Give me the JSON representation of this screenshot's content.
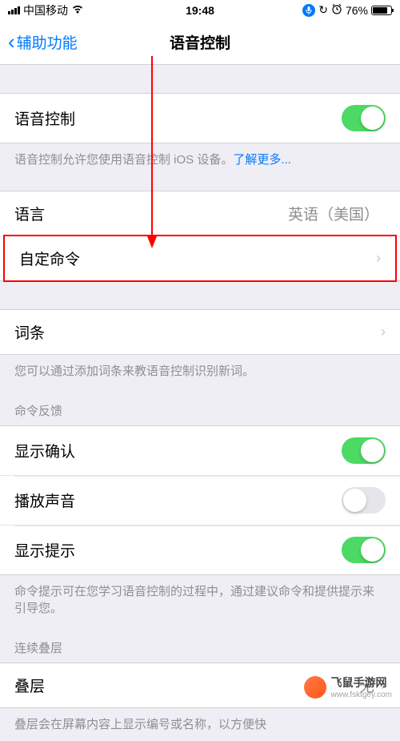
{
  "status": {
    "carrier": "中国移动",
    "time": "19:48",
    "battery_pct": "76%"
  },
  "nav": {
    "back_label": "辅助功能",
    "title": "语音控制"
  },
  "sections": {
    "main_toggle": {
      "label": "语音控制",
      "footer": "语音控制允许您使用语音控制 iOS 设备。",
      "learn_more": "了解更多..."
    },
    "language": {
      "label": "语言",
      "value": "英语（美国）"
    },
    "custom_commands": {
      "label": "自定命令"
    },
    "vocabulary": {
      "label": "词条",
      "footer": "您可以通过添加词条来教语音控制识别新词。"
    },
    "feedback": {
      "header": "命令反馈",
      "show_confirm": "显示确认",
      "play_sound": "播放声音",
      "show_hints": "显示提示",
      "footer": "命令提示可在您学习语音控制的过程中，通过建议命令和提供提示来引导您。"
    },
    "overlay": {
      "header": "连续叠层",
      "label": "叠层",
      "value": "无",
      "footer": "叠层会在屏幕内容上显示编号或名称，以方便快"
    }
  },
  "watermark": {
    "title": "飞鼠手游网",
    "url": "www.fsktgey.com"
  }
}
